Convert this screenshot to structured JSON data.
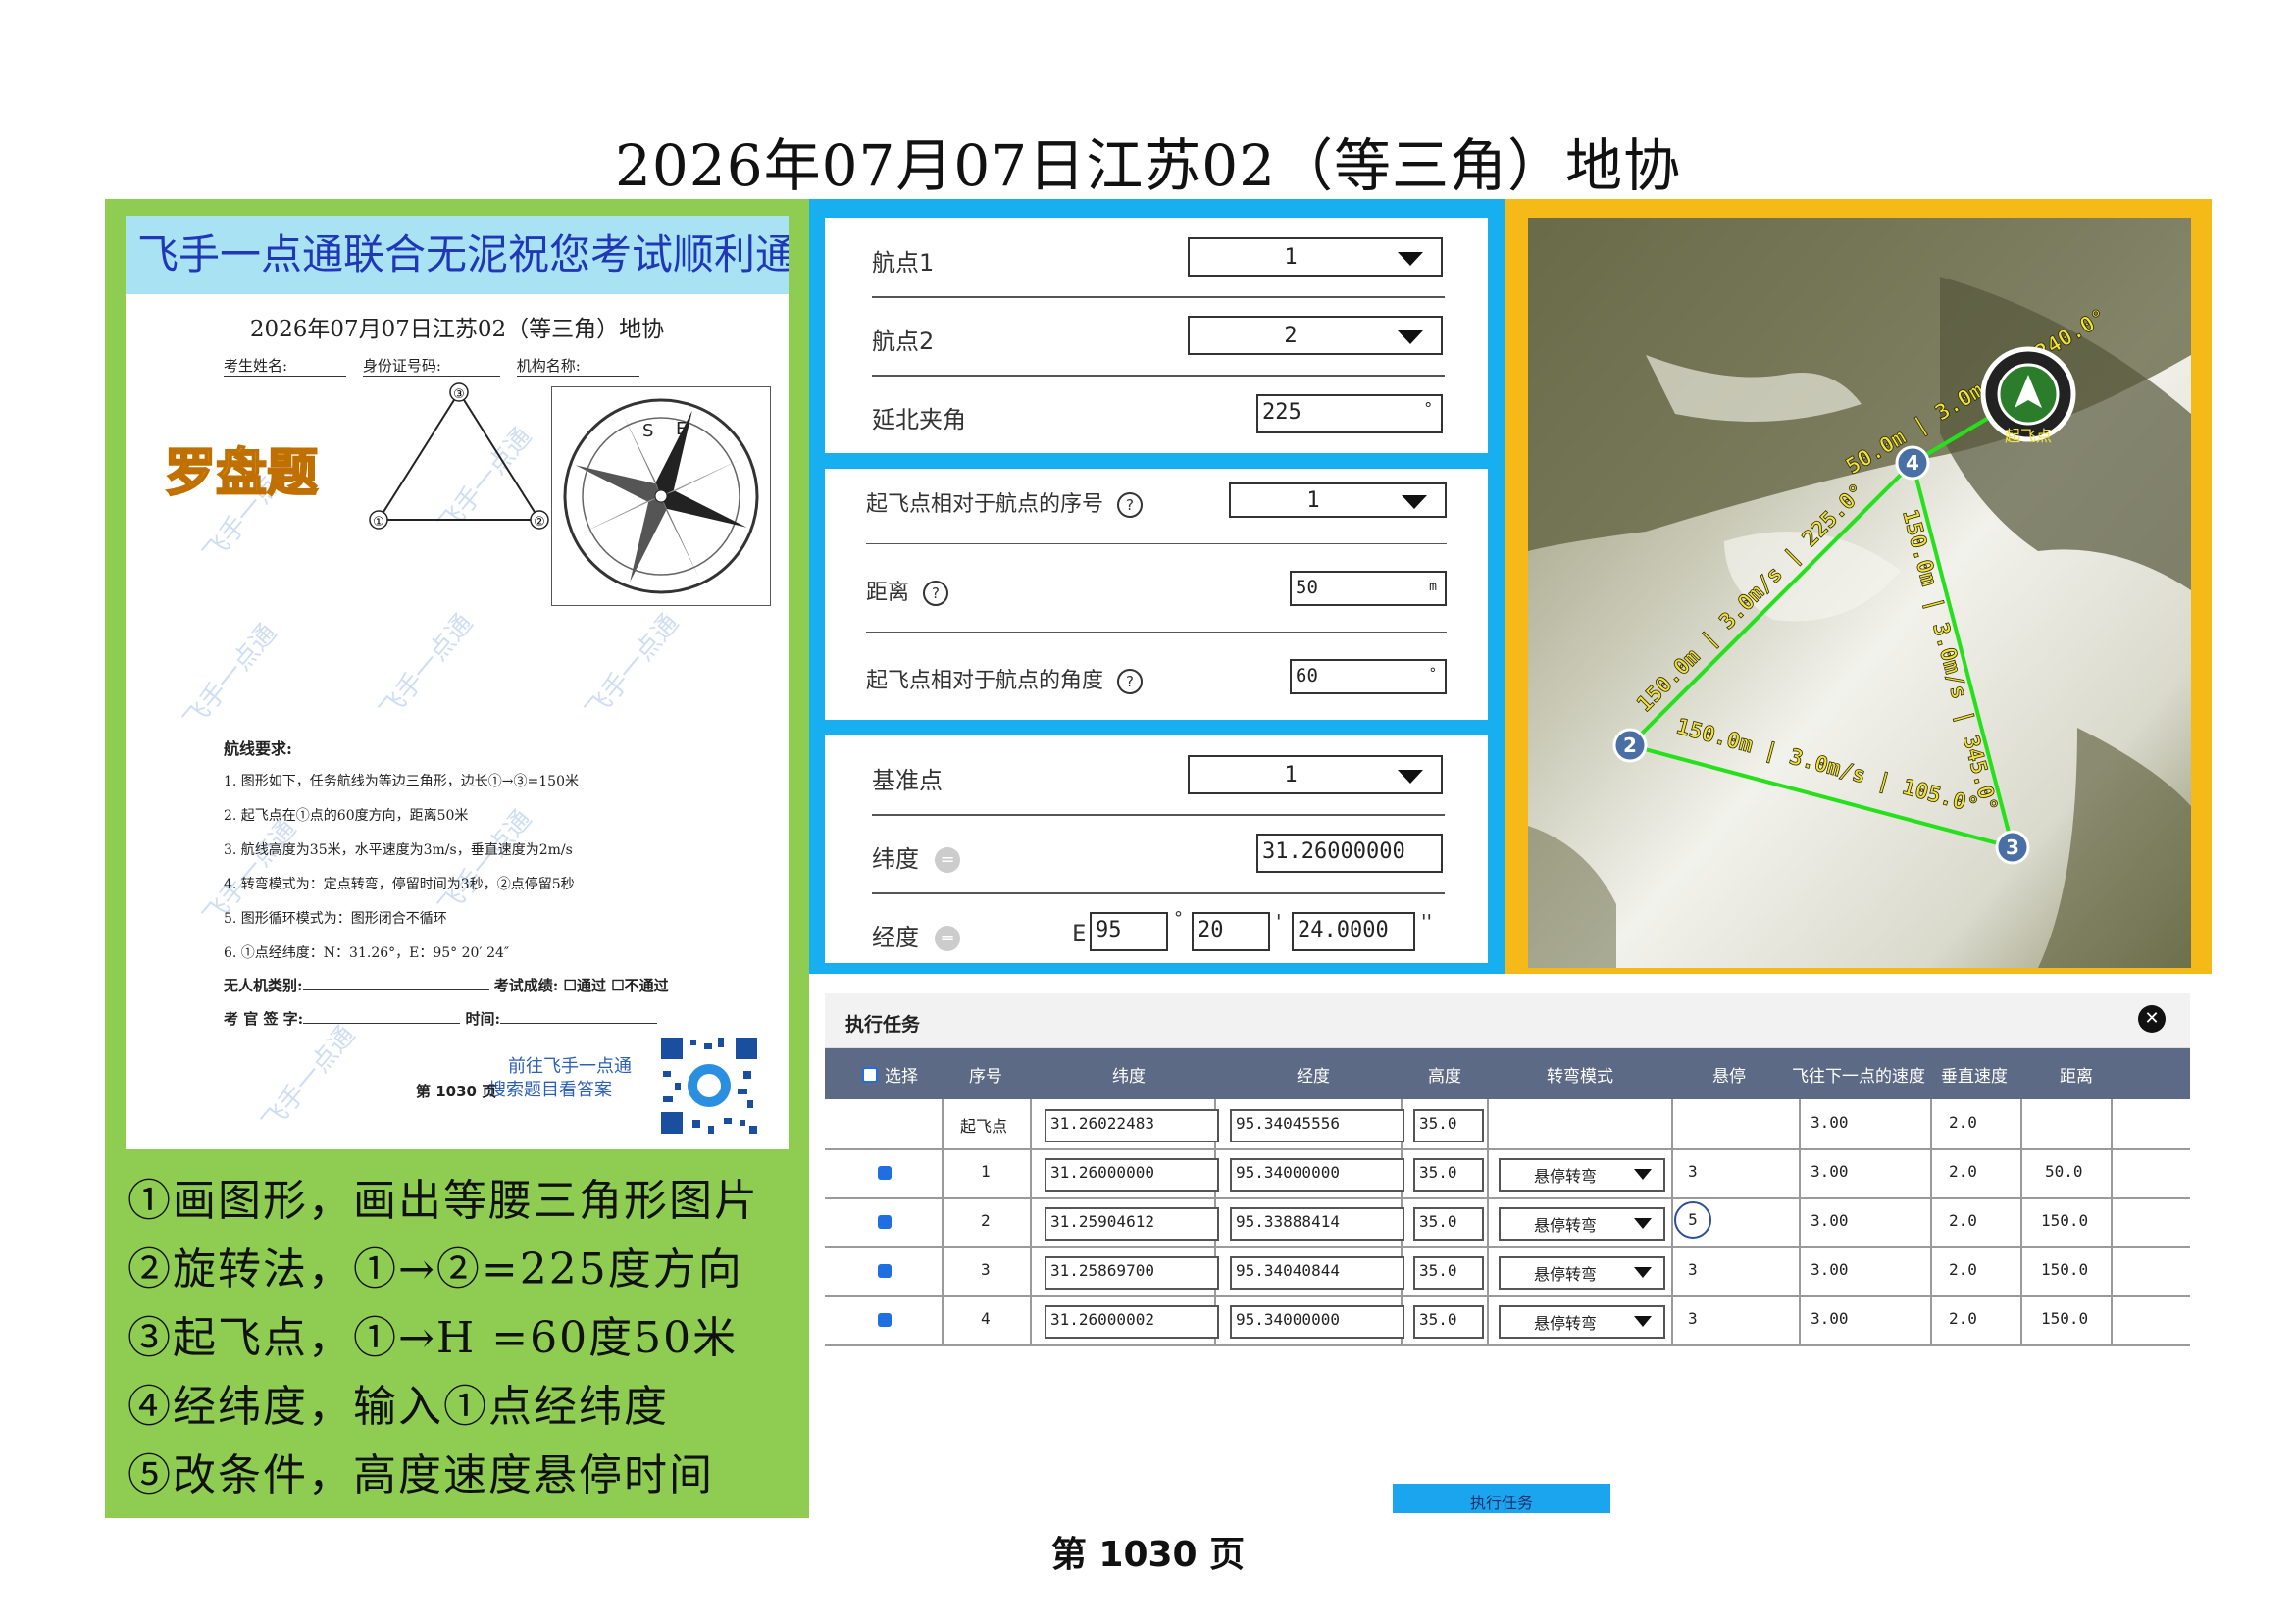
{
  "title": "2026年07月07日江苏02（等三角）地协",
  "paper": {
    "banner": "飞手一点通联合无泥祝您考试顺利通过",
    "title": "2026年07月07日江苏02（等三角）地协",
    "field_name": "考生姓名:",
    "field_id": "身份证号码:",
    "field_org": "机构名称:",
    "luopan": "罗盘题",
    "tri_labels": [
      "③",
      "①",
      "②"
    ],
    "compass_letters": [
      "S",
      "E"
    ],
    "req_title": "航线要求:",
    "req_items": [
      "1. 图形如下，任务航线为等边三角形，边长①→③=150米",
      "2. 起飞点在①点的60度方向，距离50米",
      "3. 航线高度为35米，水平速度为3m/s，垂直速度为2m/s",
      "4. 转弯模式为：定点转弯，停留时间为3秒，②点停留5秒",
      "5. 图形循环模式为：图形闭合不循环",
      "6. ①点经纬度：N：31.26°，E：95° 20′ 24″"
    ],
    "uav_label": "无人机类别:",
    "result_label": "考试成绩: ☐通过  ☐不通过",
    "examiner_label": "考 官 签 字:",
    "time_label": "时间:",
    "goto_line1": "前往飞手一点通",
    "goto_line2": "搜索题目看答案",
    "page": "第 1030 页",
    "watermark": "飞手一点通"
  },
  "steps": [
    "①画图形，画出等腰三角形图片",
    "②旋转法，①→②=225度方向",
    "③起飞点，①→H =60度50米",
    "④经纬度，输入①点经纬度",
    "⑤改条件，高度速度悬停时间"
  ],
  "form1": {
    "wp1_label": "航点1",
    "wp1_value": "1",
    "wp2_label": "航点2",
    "wp2_value": "2",
    "angle_label": "延北夹角",
    "angle_value": "225",
    "angle_unit": "°"
  },
  "form2": {
    "seq_label": "起飞点相对于航点的序号",
    "seq_value": "1",
    "dist_label": "距离",
    "dist_value": "50",
    "dist_unit": "m",
    "rel_angle_label": "起飞点相对于航点的角度",
    "rel_angle_value": "60",
    "rel_angle_unit": "°",
    "help": "?"
  },
  "form3": {
    "base_label": "基准点",
    "base_value": "1",
    "lat_label": "纬度",
    "lat_value": "31.26000000",
    "lon_label": "经度",
    "lon_prefix": "E",
    "lon_deg": "95",
    "lon_min": "20",
    "lon_sec": "24.0000",
    "deg_mark": "°",
    "min_mark": "'",
    "sec_mark": "''",
    "eq": "="
  },
  "map": {
    "leg_21": "150.0m | 3.0m/s | 225.0°",
    "leg_23": "150.0m | 3.0m/s | 105.0°",
    "leg_43": "150.0m | 3.0m/s | 345.0°",
    "leg_4h": "50.0m | 3.0m/s | 240.0°",
    "home_label": "起飞点",
    "wp_labels": [
      "2",
      "4",
      "3"
    ]
  },
  "task": {
    "title": "执行任务",
    "close": "✕",
    "headers": [
      "选择",
      "序号",
      "纬度",
      "经度",
      "高度",
      "转弯模式",
      "悬停",
      "飞往下一点的速度",
      "垂直速度",
      "距离"
    ],
    "rows": [
      {
        "seq": "起飞点",
        "lat": "31.26022483",
        "lon": "95.34045556",
        "alt": "35.0",
        "turn": "",
        "hover": "",
        "speed": "3.00",
        "vspeed": "2.0",
        "dist": ""
      },
      {
        "seq": "1",
        "lat": "31.26000000",
        "lon": "95.34000000",
        "alt": "35.0",
        "turn": "悬停转弯",
        "hover": "3",
        "speed": "3.00",
        "vspeed": "2.0",
        "dist": "50.0"
      },
      {
        "seq": "2",
        "lat": "31.25904612",
        "lon": "95.33888414",
        "alt": "35.0",
        "turn": "悬停转弯",
        "hover": "5",
        "speed": "3.00",
        "vspeed": "2.0",
        "dist": "150.0"
      },
      {
        "seq": "3",
        "lat": "31.25869700",
        "lon": "95.34040844",
        "alt": "35.0",
        "turn": "悬停转弯",
        "hover": "3",
        "speed": "3.00",
        "vspeed": "2.0",
        "dist": "150.0"
      },
      {
        "seq": "4",
        "lat": "31.26000002",
        "lon": "95.34000000",
        "alt": "35.0",
        "turn": "悬停转弯",
        "hover": "3",
        "speed": "3.00",
        "vspeed": "2.0",
        "dist": "150.0"
      }
    ],
    "exec_button": "执行任务"
  },
  "footer": "第 1030 页"
}
